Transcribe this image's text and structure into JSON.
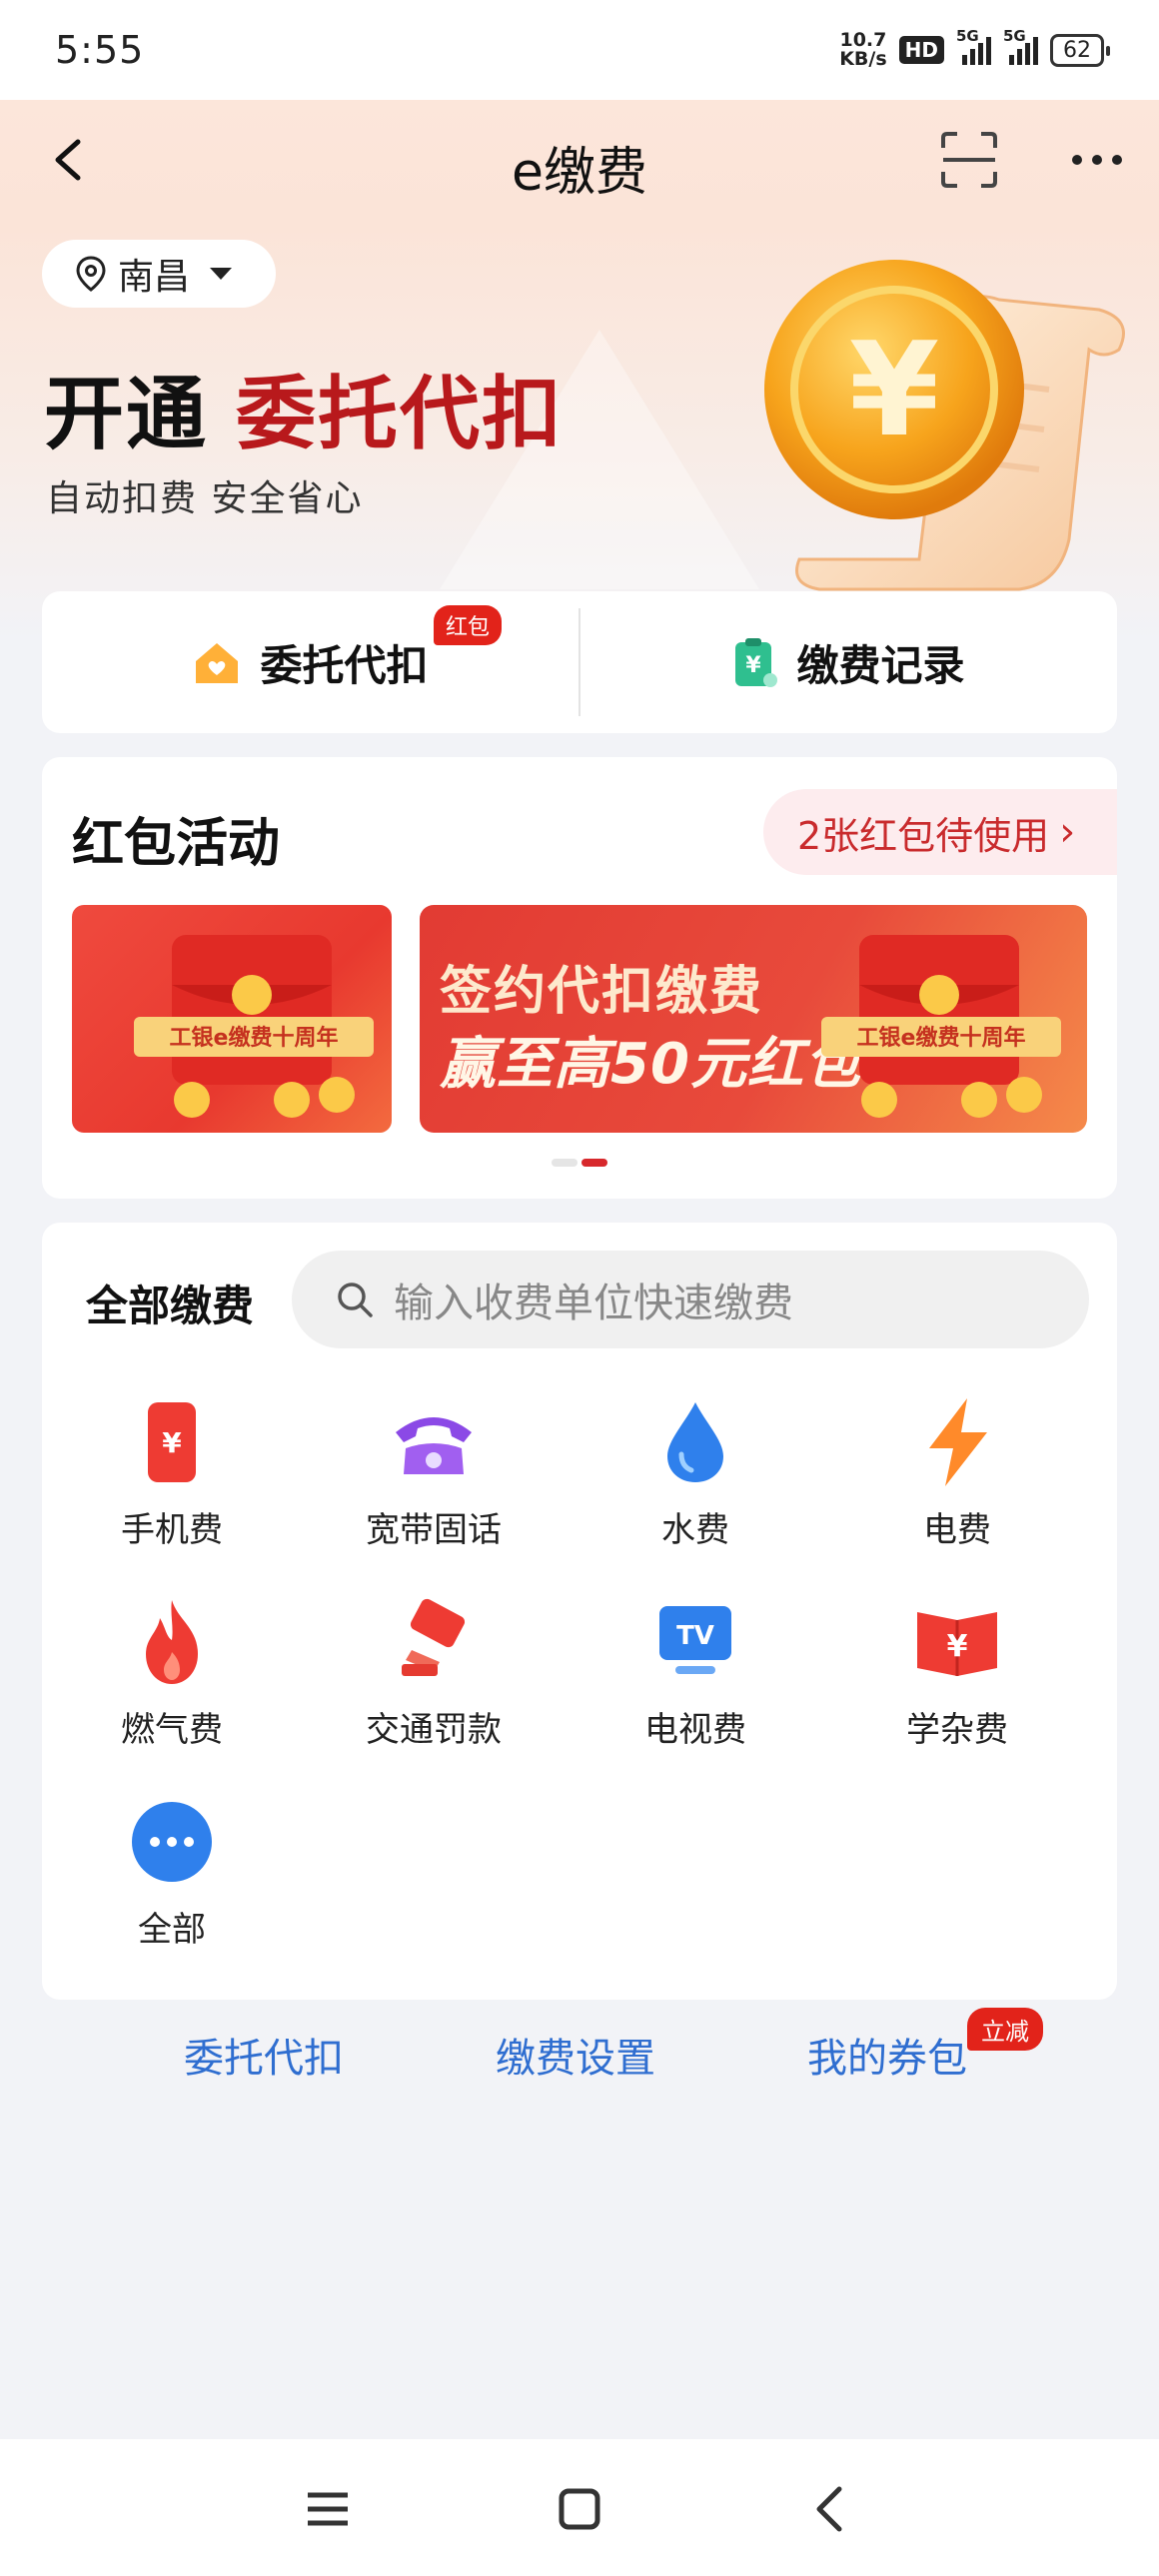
{
  "status_bar": {
    "time": "5:55",
    "net_speed_value": "10.7",
    "net_speed_unit": "KB/s",
    "hd_label": "HD",
    "network_1": "5G",
    "network_2": "5G",
    "battery": "62"
  },
  "header": {
    "title": "e缴费",
    "back_icon": "back-arrow-icon",
    "scan_icon": "scan-icon",
    "more_icon": "more-icon"
  },
  "location": {
    "city": "南昌"
  },
  "hero": {
    "title_prefix": "开通",
    "title_accent": "委托代扣",
    "subtitle": "自动扣费 安全省心"
  },
  "quick_actions": {
    "items": [
      {
        "label": "委托代扣",
        "icon": "house-heart-icon",
        "badge": "红包"
      },
      {
        "label": "缴费记录",
        "icon": "clipboard-yuan-icon"
      }
    ]
  },
  "red_packet": {
    "title": "红包活动",
    "pending": "2张红包待使用",
    "banner_line1": "签约代扣缴费",
    "banner_line2": "赢至高50元红包",
    "ribbon": "工银e缴费十周年",
    "slide_count": 2,
    "active_slide": 2
  },
  "payments": {
    "title": "全部缴费",
    "search_placeholder": "输入收费单位快速缴费",
    "items": [
      {
        "label": "手机费",
        "icon": "phone-bill-icon"
      },
      {
        "label": "宽带固话",
        "icon": "landline-icon"
      },
      {
        "label": "水费",
        "icon": "water-drop-icon"
      },
      {
        "label": "电费",
        "icon": "lightning-icon"
      },
      {
        "label": "燃气费",
        "icon": "flame-icon"
      },
      {
        "label": "交通罚款",
        "icon": "traffic-camera-icon"
      },
      {
        "label": "电视费",
        "icon": "tv-icon"
      },
      {
        "label": "学杂费",
        "icon": "book-yuan-icon"
      },
      {
        "label": "全部",
        "icon": "more-dots-icon"
      }
    ]
  },
  "footer_links": {
    "entrust": "委托代扣",
    "settings": "缴费设置",
    "coupons": "我的券包",
    "coupons_badge": "立减"
  },
  "colors": {
    "accent_red": "#b8191c",
    "link_blue": "#2f6ed0",
    "badge_red": "#e2231a"
  }
}
